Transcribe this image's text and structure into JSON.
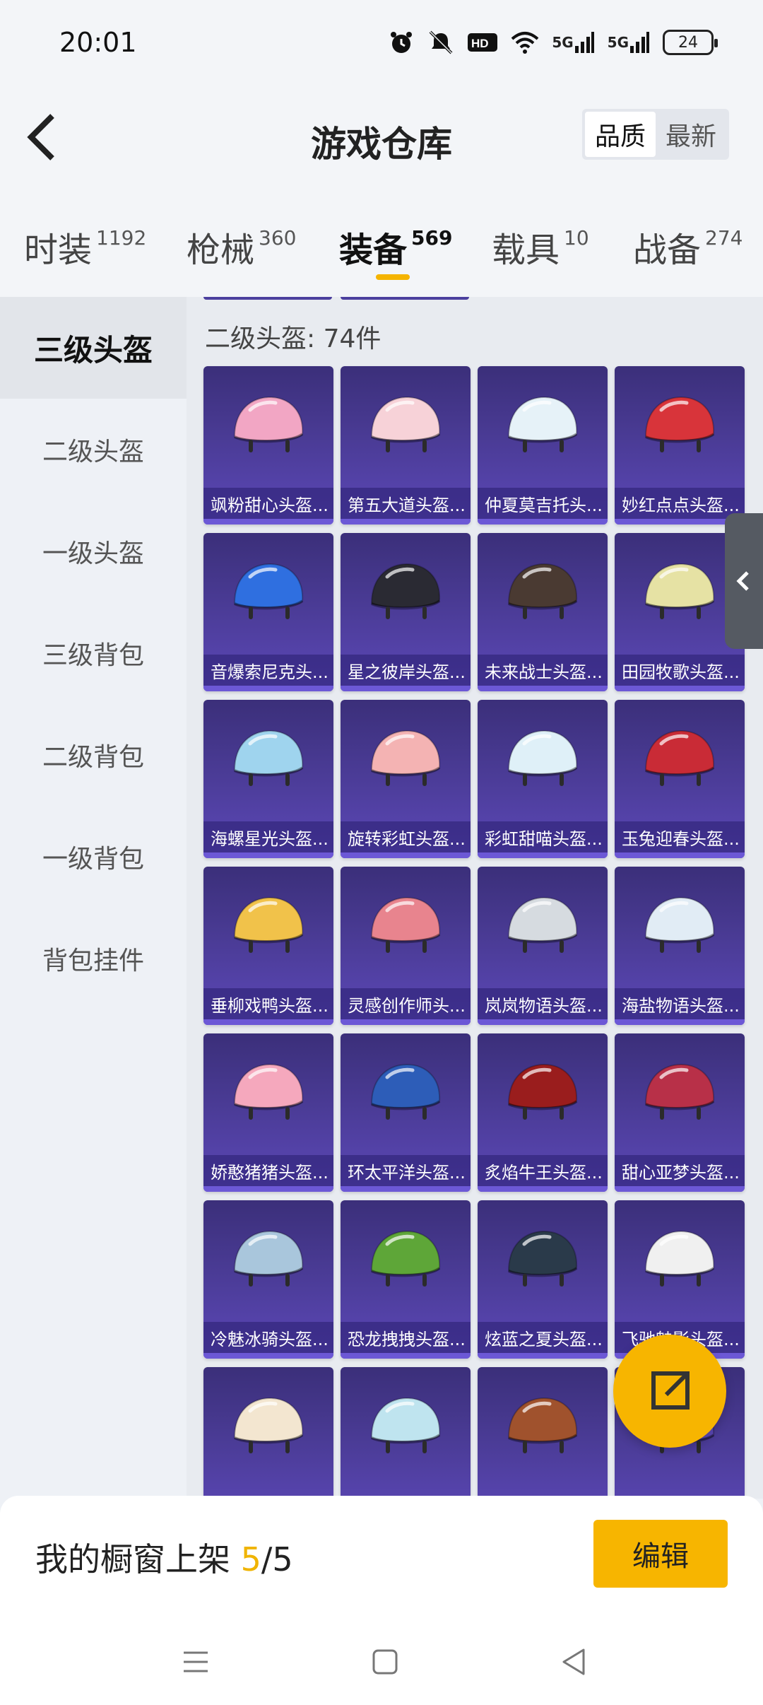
{
  "status_bar": {
    "time": "20:01",
    "battery": "24",
    "net1": "5G",
    "net2": "5G",
    "hd": "HD2"
  },
  "header": {
    "title": "游戏仓库",
    "sort_options": [
      "品质",
      "最新"
    ],
    "active_sort": "品质"
  },
  "tabs": [
    {
      "label": "时装",
      "count": "1192"
    },
    {
      "label": "枪械",
      "count": "360"
    },
    {
      "label": "装备",
      "count": "569"
    },
    {
      "label": "载具",
      "count": "10"
    },
    {
      "label": "战备",
      "count": "274"
    }
  ],
  "active_tab": "装备",
  "categories": [
    "三级头盔",
    "二级头盔",
    "一级头盔",
    "三级背包",
    "二级背包",
    "一级背包",
    "背包挂件"
  ],
  "active_category": "三级头盔",
  "section_title": "二级头盔: 74件",
  "items": [
    {
      "name": "飒粉甜心头盔...",
      "color": "#f2a6c4"
    },
    {
      "name": "第五大道头盔...",
      "color": "#f7d2d8"
    },
    {
      "name": "仲夏莫吉托头...",
      "color": "#e6f2f8"
    },
    {
      "name": "妙红点点头盔...",
      "color": "#d8343a"
    },
    {
      "name": "音爆索尼克头...",
      "color": "#2f6fe0"
    },
    {
      "name": "星之彼岸头盔...",
      "color": "#2a2a33"
    },
    {
      "name": "未来战士头盔...",
      "color": "#4a3a32"
    },
    {
      "name": "田园牧歌头盔...",
      "color": "#e6e2a4"
    },
    {
      "name": "海螺星光头盔...",
      "color": "#9fd4ee"
    },
    {
      "name": "旋转彩虹头盔...",
      "color": "#f4b3b3"
    },
    {
      "name": "彩虹甜喵头盔...",
      "color": "#dff0f8"
    },
    {
      "name": "玉兔迎春头盔...",
      "color": "#c92b36"
    },
    {
      "name": "垂柳戏鸭头盔...",
      "color": "#f1c24a"
    },
    {
      "name": "灵感创作师头...",
      "color": "#e8848e"
    },
    {
      "name": "岚岚物语头盔...",
      "color": "#d6dbe0"
    },
    {
      "name": "海盐物语头盔...",
      "color": "#e1ecf5"
    },
    {
      "name": "娇憨猪猪头盔...",
      "color": "#f5a8bd"
    },
    {
      "name": "环太平洋头盔...",
      "color": "#2d5db8"
    },
    {
      "name": "炙焰牛王头盔...",
      "color": "#9a1d1d"
    },
    {
      "name": "甜心亚梦头盔...",
      "color": "#b83048"
    },
    {
      "name": "冷魅冰骑头盔...",
      "color": "#a9c6dc"
    },
    {
      "name": "恐龙拽拽头盔...",
      "color": "#5ea638"
    },
    {
      "name": "炫蓝之夏头盔...",
      "color": "#2a3a4a"
    },
    {
      "name": "飞驰魅影头盔...",
      "color": "#f0f0f0"
    },
    {
      "name": "",
      "color": "#f3e6d0"
    },
    {
      "name": "",
      "color": "#bfe4ef"
    },
    {
      "name": "",
      "color": "#a0522d"
    },
    {
      "name": "",
      "color": "#5c48b8"
    }
  ],
  "bottom_bar": {
    "label": "我的橱窗上架 ",
    "current": "5",
    "sep": "/",
    "total": "5",
    "edit_label": "编辑"
  },
  "icons": {
    "back": "chevron-left-icon",
    "fab": "share-icon",
    "handle": "chevron-left-icon"
  }
}
